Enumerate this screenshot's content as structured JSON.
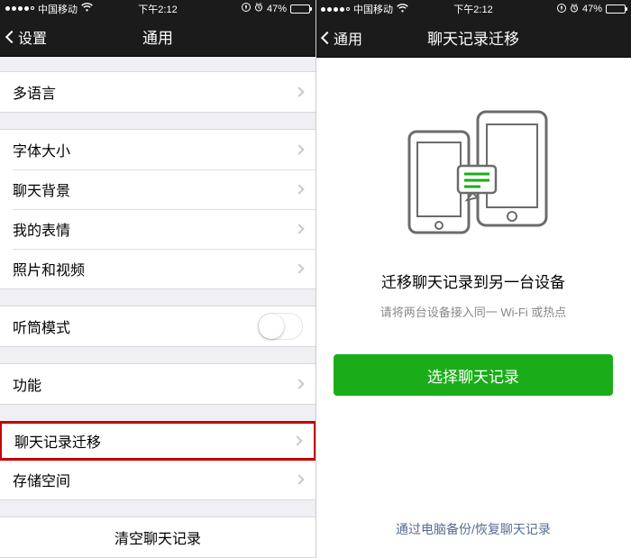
{
  "status": {
    "carrier": "中国移动",
    "time": "下午2:12",
    "battery_pct": "47%"
  },
  "left": {
    "back_label": "设置",
    "title": "通用",
    "rows": {
      "lang": "多语言",
      "font": "字体大小",
      "bg": "聊天背景",
      "sticker": "我的表情",
      "media": "照片和视频",
      "earpiece": "听筒模式",
      "func": "功能",
      "migrate": "聊天记录迁移",
      "storage": "存储空间",
      "clear": "清空聊天记录"
    }
  },
  "right": {
    "back_label": "通用",
    "title": "聊天记录迁移",
    "heading": "迁移聊天记录到另一台设备",
    "subtitle": "请将两台设备接入同一 Wi-Fi 或热点",
    "button": "选择聊天记录",
    "footer": "通过电脑备份/恢复聊天记录"
  }
}
